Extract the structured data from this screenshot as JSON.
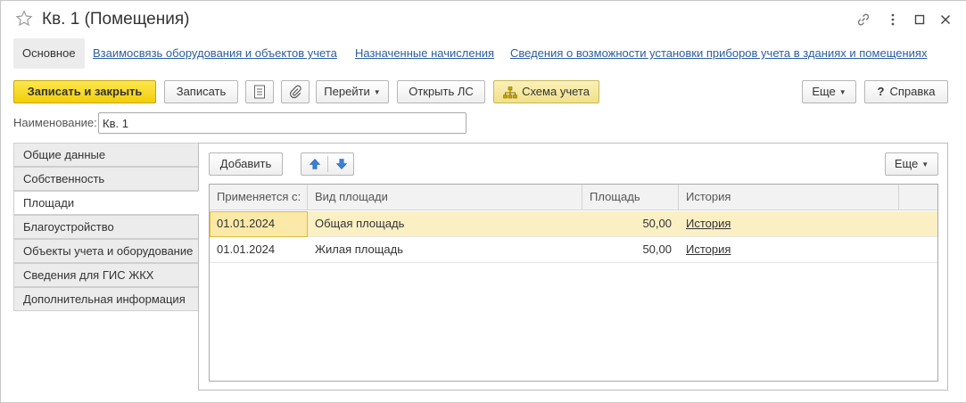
{
  "window": {
    "title": "Кв. 1 (Помещения)"
  },
  "nav": {
    "items": [
      {
        "label": "Основное",
        "active": true
      },
      {
        "label": "Взаимосвязь оборудования и объектов учета",
        "active": false
      },
      {
        "label": "Назначенные начисления",
        "active": false
      },
      {
        "label": "Сведения о возможности установки приборов учета в зданиях и помещениях",
        "active": false
      }
    ]
  },
  "toolbar": {
    "save_close": "Записать и закрыть",
    "save": "Записать",
    "goto": "Перейти",
    "open_ls": "Открыть ЛС",
    "scheme": "Схема учета",
    "more": "Еще",
    "help": "Справка",
    "help_mark": "?"
  },
  "form": {
    "name_label": "Наименование:",
    "name_value": "Кв. 1"
  },
  "tabs": [
    {
      "label": "Общие данные",
      "active": false
    },
    {
      "label": "Собственность",
      "active": false
    },
    {
      "label": "Площади",
      "active": true
    },
    {
      "label": "Благоустройство",
      "active": false
    },
    {
      "label": "Объекты учета и оборудование",
      "active": false
    },
    {
      "label": "Сведения для ГИС ЖКХ",
      "active": false
    },
    {
      "label": "Дополнительная информация",
      "active": false
    }
  ],
  "panel": {
    "add": "Добавить",
    "more": "Еще"
  },
  "table": {
    "columns": [
      "Применяется с:",
      "Вид площади",
      "Площадь",
      "История"
    ],
    "rows": [
      {
        "date": "01.01.2024",
        "kind": "Общая площадь",
        "area": "50,00",
        "history": "История",
        "selected": true
      },
      {
        "date": "01.01.2024",
        "kind": "Жилая площадь",
        "area": "50,00",
        "history": "История",
        "selected": false
      }
    ]
  },
  "colors": {
    "primary_button": "#f2cd0a",
    "link": "#2c5ea1",
    "selected_row": "#fbf0c4",
    "arrow": "#3a7fd5"
  }
}
